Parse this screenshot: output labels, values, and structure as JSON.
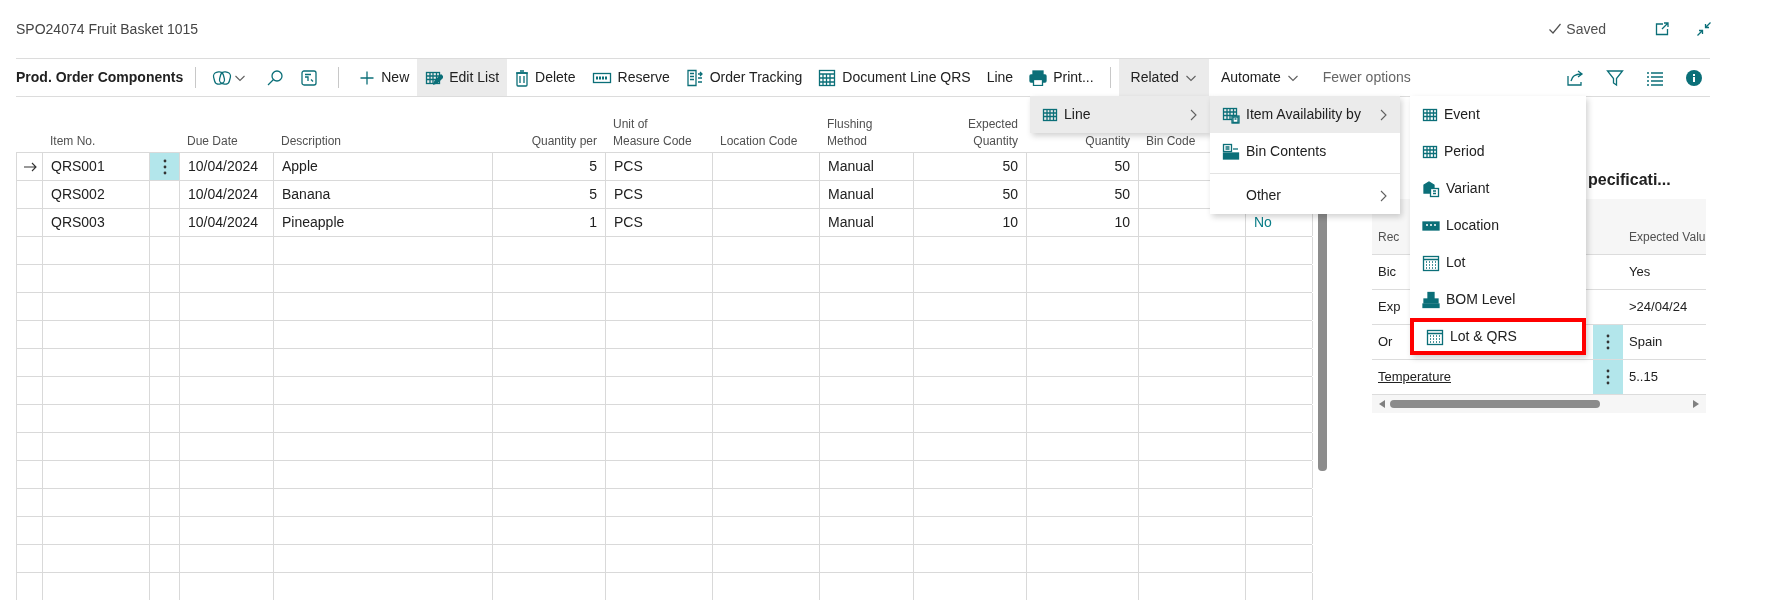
{
  "title": "SPO24074 Fruit Basket 1015",
  "status": "Saved",
  "toolbar": {
    "page_title": "Prod. Order Components",
    "actions": [
      {
        "kind": "command",
        "label": "New",
        "selected": false
      },
      {
        "kind": "command",
        "label": "Edit List",
        "selected": true
      },
      {
        "kind": "command",
        "label": "Delete",
        "selected": false
      },
      {
        "kind": "command",
        "label": "Reserve",
        "selected": false
      },
      {
        "kind": "command",
        "label": "Order Tracking",
        "selected": false
      },
      {
        "kind": "command",
        "label": "Document Line QRS",
        "selected": false
      },
      {
        "kind": "plain",
        "label": "Line",
        "selected": false
      },
      {
        "kind": "command",
        "label": "Print...",
        "selected": false
      },
      {
        "kind": "dropdown",
        "label": "Related",
        "selected": true
      },
      {
        "kind": "dropdown",
        "label": "Automate",
        "selected": false
      },
      {
        "kind": "toggle",
        "label": "Fewer options",
        "selected": false
      }
    ]
  },
  "table": {
    "columns": [
      {
        "label": "Item No."
      },
      {
        "label": "Due Date"
      },
      {
        "label": "Description"
      },
      {
        "label": "Quantity per"
      },
      {
        "label": "Unit of Measure Code"
      },
      {
        "label": "Location Code"
      },
      {
        "label": "Flushing Method"
      },
      {
        "label": "Expected Quantity"
      },
      {
        "label": "Quantity"
      },
      {
        "label": "Bin Code"
      },
      {}
    ],
    "rows": [
      {
        "current": true,
        "cells": [
          "QRS001",
          "10/04/2024",
          "Apple",
          "5",
          "PCS",
          null,
          "Manual",
          "50",
          "50",
          null,
          null
        ]
      },
      {
        "current": false,
        "cells": [
          "QRS002",
          "10/04/2024",
          "Banana",
          "5",
          "PCS",
          null,
          "Manual",
          "50",
          "50",
          null,
          null
        ]
      },
      {
        "current": false,
        "cells": [
          "QRS003",
          "10/04/2024",
          "Pineapple",
          "1",
          "PCS",
          null,
          "Manual",
          "10",
          "10",
          null,
          "No"
        ]
      }
    ]
  },
  "menus": [
    {
      "items": [
        {
          "label": "Line",
          "submenu": true,
          "selected": true,
          "highlighted": false
        }
      ]
    },
    {
      "items": [
        {
          "label": "Item Availability by",
          "submenu": true,
          "selected": true,
          "highlighted": false,
          "divider_before": false
        },
        {
          "label": "Bin Contents",
          "submenu": false,
          "selected": false,
          "highlighted": false,
          "divider_before": false
        },
        {
          "label": "Other",
          "submenu": true,
          "selected": false,
          "highlighted": false,
          "divider_before": true
        }
      ]
    },
    {
      "items": [
        {
          "label": "Event",
          "selected": false,
          "highlighted": false
        },
        {
          "label": "Period",
          "selected": false,
          "highlighted": false
        },
        {
          "label": "Variant",
          "selected": false,
          "highlighted": false
        },
        {
          "label": "Location",
          "selected": false,
          "highlighted": false
        },
        {
          "label": "Lot",
          "selected": false,
          "highlighted": false
        },
        {
          "label": "BOM Level",
          "selected": false,
          "highlighted": false
        },
        {
          "label": "Lot & QRS",
          "selected": false,
          "highlighted": true
        }
      ]
    }
  ],
  "panel": {
    "title": "pecificati...",
    "columns": [
      {
        "label": "Rec"
      },
      {
        "label": "Expected Valu"
      }
    ],
    "rows": [
      {
        "name": "Bic",
        "value": "Yes",
        "link": false,
        "menu_button": false
      },
      {
        "name": "Exp",
        "value": ">24/04/24",
        "link": false,
        "menu_button": false
      },
      {
        "name": "Or",
        "value": "Spain",
        "link": false,
        "menu_button": true
      },
      {
        "name": "Temperature",
        "value": "5..15",
        "link": true,
        "menu_button": true
      }
    ]
  }
}
